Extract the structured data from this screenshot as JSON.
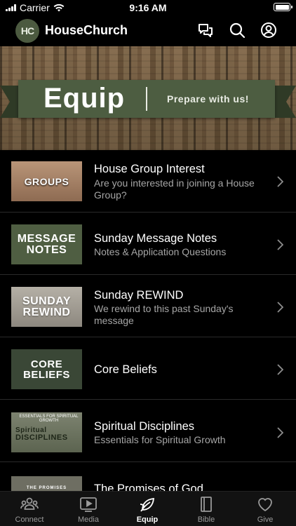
{
  "status_bar": {
    "carrier": "Carrier",
    "time": "9:16 AM"
  },
  "header": {
    "logo_text": "HC",
    "title": "HouseChurch",
    "icons": [
      "chat-icon",
      "search-icon",
      "profile-icon"
    ]
  },
  "banner": {
    "title": "Equip",
    "subtitle": "Prepare with us!"
  },
  "list": [
    {
      "thumb_lines": [
        "GROUPS"
      ],
      "title": "House Group Interest",
      "subtitle": "Are you interested in joining a House Group?"
    },
    {
      "thumb_lines": [
        "MESSAGE",
        "NOTES"
      ],
      "title": "Sunday Message Notes",
      "subtitle": "Notes & Application Questions"
    },
    {
      "thumb_lines": [
        "SUNDAY",
        "REWIND"
      ],
      "title": "Sunday REWIND",
      "subtitle": "We rewind to this past Sunday's message"
    },
    {
      "thumb_lines": [
        "CORE",
        "BELIEFS"
      ],
      "title": "Core Beliefs",
      "subtitle": ""
    },
    {
      "thumb_lines": [
        "ESSENTIALS FOR SPIRITUAL GROWTH",
        "Spiritual",
        "DISCIPLINES"
      ],
      "title": "Spiritual Disciplines",
      "subtitle": "Essentials for Spiritual Growth"
    },
    {
      "thumb_lines": [
        "THE PROMISES"
      ],
      "title": "The Promises of God",
      "subtitle": ""
    }
  ],
  "tabs": [
    {
      "label": "Connect",
      "icon": "people-icon",
      "active": false
    },
    {
      "label": "Media",
      "icon": "play-icon",
      "active": false
    },
    {
      "label": "Equip",
      "icon": "leaf-icon",
      "active": true
    },
    {
      "label": "Bible",
      "icon": "book-icon",
      "active": false
    },
    {
      "label": "Give",
      "icon": "heart-icon",
      "active": false
    }
  ],
  "colors": {
    "accent_green": "#4d5d41",
    "background": "#000000",
    "subtitle_gray": "#a6a6a6"
  }
}
